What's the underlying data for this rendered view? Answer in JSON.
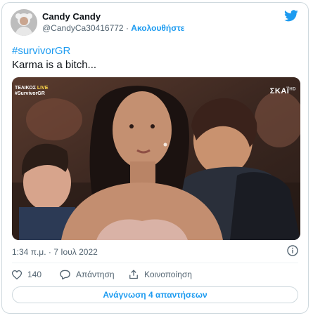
{
  "author": {
    "name": "Candy Candy",
    "handle": "@CandyCa30416772",
    "separator": "·",
    "follow_label": "Ακολουθήστε"
  },
  "tweet": {
    "hashtag": "#survivorGR",
    "text": "Karma is a bitch..."
  },
  "media": {
    "logo_top_left_line1": "ΤΕΛΙΚΟΣ",
    "logo_top_left_live": "LIVE",
    "logo_top_left_line2": "#SurvivorGR",
    "logo_top_right": "ΣΚΑΪ",
    "logo_top_right_suffix": "HD"
  },
  "meta": {
    "timestamp": "1:34 π.μ. · 7 Ιουλ 2022"
  },
  "actions": {
    "like_count": "140",
    "reply_label": "Απάντηση",
    "share_label": "Κοινοποίηση"
  },
  "read_replies_label": "Ανάγνωση 4 απαντήσεων",
  "colors": {
    "accent": "#1d9bf0",
    "text": "#0f1419",
    "muted": "#536471",
    "border": "#cfd9de"
  },
  "icons": [
    "twitter-logo-icon",
    "info-icon",
    "heart-icon",
    "reply-icon",
    "share-icon"
  ]
}
